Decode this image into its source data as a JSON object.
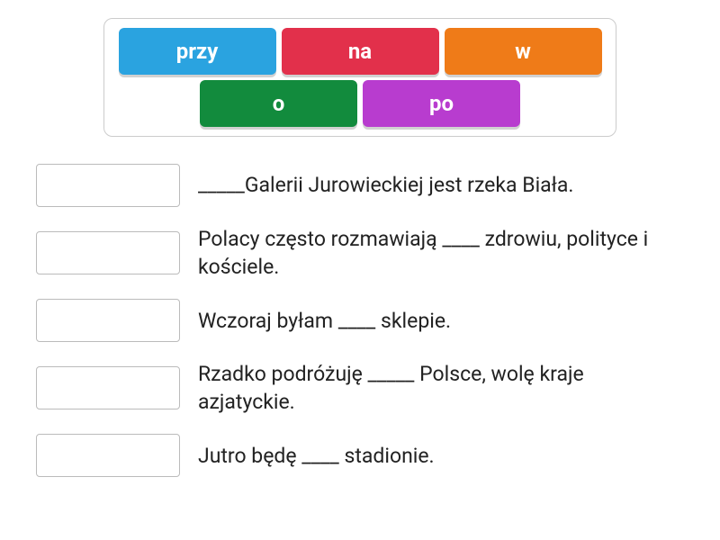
{
  "word_bank": {
    "items": [
      {
        "label": "przy",
        "color": "blue"
      },
      {
        "label": "na",
        "color": "red"
      },
      {
        "label": "w",
        "color": "orange"
      },
      {
        "label": "o",
        "color": "green"
      },
      {
        "label": "po",
        "color": "purple"
      }
    ]
  },
  "questions": [
    {
      "text": "_____Galerii Jurowieckiej jest rzeka Biała."
    },
    {
      "text": "Polacy często rozmawiają ____ zdrowiu, polityce i kościele."
    },
    {
      "text": "Wczoraj byłam ____ sklepie."
    },
    {
      "text": "Rzadko podróżuję _____ Polsce, wolę kraje azjatyckie."
    },
    {
      "text": "Jutro będę ____ stadionie."
    }
  ]
}
